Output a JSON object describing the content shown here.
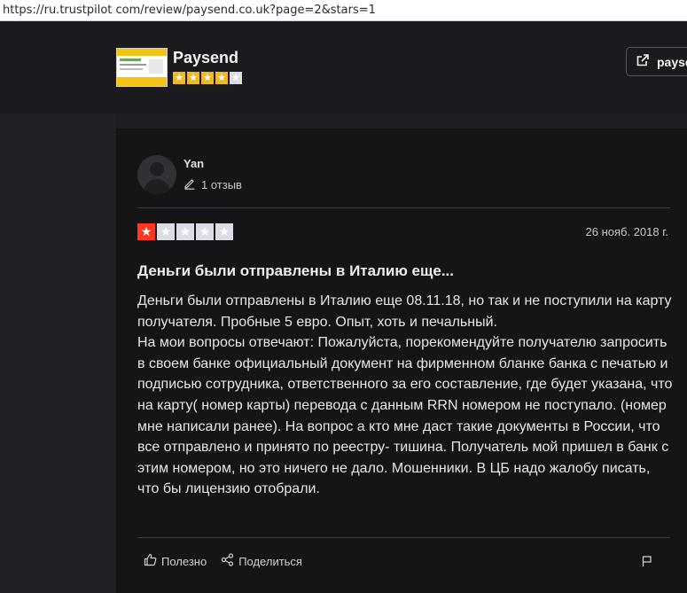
{
  "browser": {
    "url": "https://ru.trustpilot com/review/paysend.co.uk?page=2&stars=1"
  },
  "company": {
    "name": "Paysend",
    "rating_stars": 4,
    "visit_label": "paysen"
  },
  "review": {
    "reviewer_name": "Yan",
    "review_count": "1 отзыв",
    "rating_stars": 1,
    "date": "26 нояб. 2018 г.",
    "title": "Деньги были отправлены в Италию еще...",
    "body_paragraphs": [
      "Деньги были отправлены в Италию еще 08.11.18, но так и не поступили на карту получателя. Пробные 5 евро. Опыт, хоть и печальный.",
      "На мои вопросы отвечают: Пожалуйста, порекомендуйте получателю запросить в своем банке официальный документ на фирменном бланке банка с печатью и подписью сотрудника, ответственного за его составление, где будет указана, что на карту( номер карты) перевода с данным RRN номером не поступало. (номер мне написали ранее). На вопрос а кто мне даст такие документы в России, что все отправлено и принято по реестру- тишина. Получатель мой пришел в банк с этим номером, но это ничего не дало. Мошенники. В ЦБ надо жалобу писать, что бы лицензию отобрали."
    ],
    "helpful_label": "Полезно",
    "share_label": "Поделиться"
  },
  "icons": {
    "external_link": "external-link-icon",
    "pencil": "pencil-icon",
    "thumbs_up": "thumbs-up-icon",
    "share": "share-icon",
    "flag": "flag-icon",
    "star": "star-icon"
  },
  "colors": {
    "background": "#1b1b1f",
    "card": "#151518",
    "star_company": "#f2b91c",
    "star_review": "#ff3722",
    "star_empty": "#dcdce6"
  }
}
